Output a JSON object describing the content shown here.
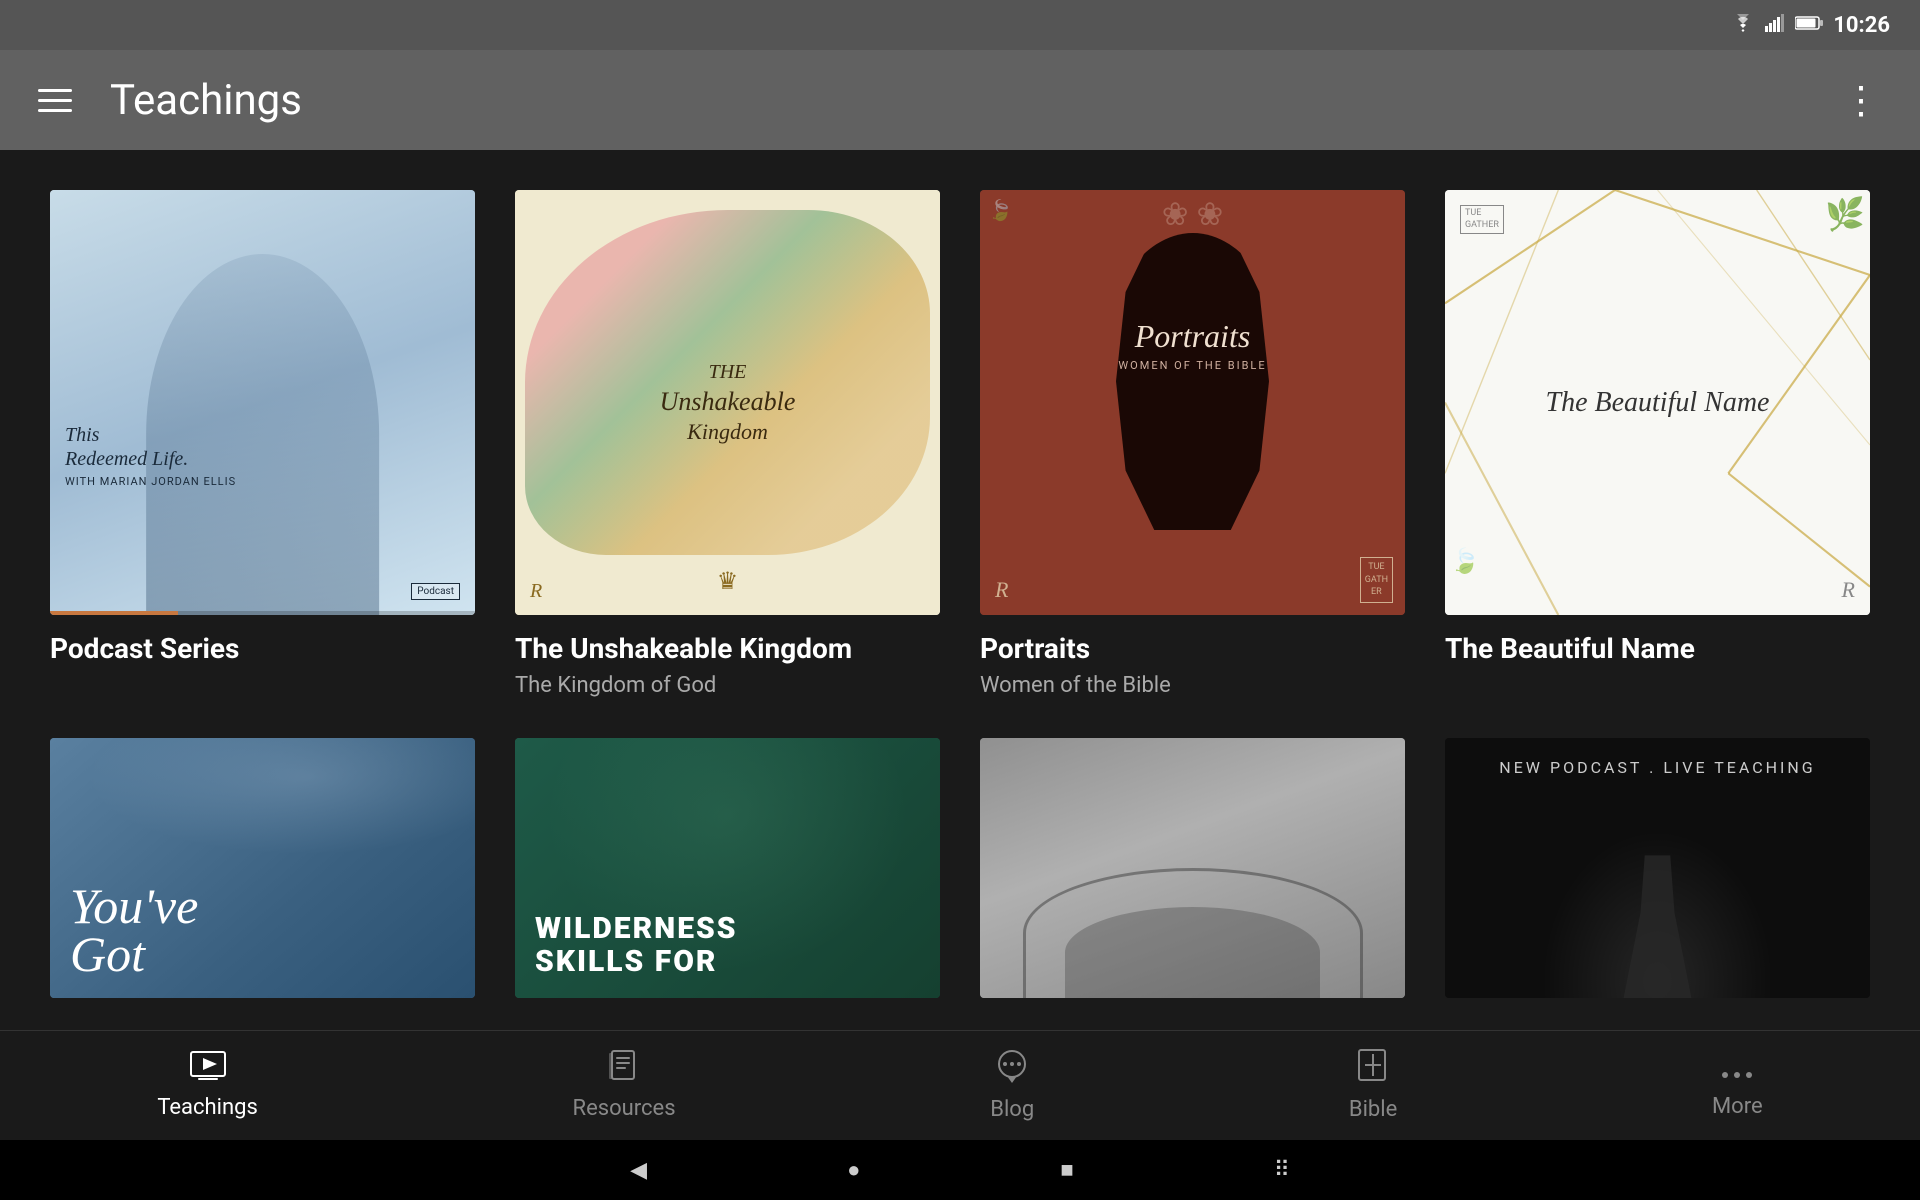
{
  "statusBar": {
    "time": "10:26",
    "wifiIcon": "wifi",
    "signalIcon": "signal",
    "batteryIcon": "battery"
  },
  "appBar": {
    "title": "Teachings",
    "menuIcon": "hamburger",
    "moreIcon": "more-vertical"
  },
  "cards": [
    {
      "id": "podcast-series",
      "imageAlt": "This Redeemed Life Podcast with Marian Jordan Ellis",
      "title": "Podcast Series",
      "subtitle": "",
      "imageText1": "This Redeemed Life",
      "imageText2": "WITH MARIAN JORDAN ELLIS",
      "imageText3": "Podcast"
    },
    {
      "id": "unshakeable-kingdom",
      "imageAlt": "The Unshakeable Kingdom colorful artwork",
      "title": "The Unshakeable Kingdom",
      "subtitle": "The Kingdom of God",
      "imageText1": "THE Unshakeable Kingdom"
    },
    {
      "id": "portraits",
      "imageAlt": "Portraits Women of the Bible red cover",
      "title": "Portraits",
      "subtitle": "Women of the Bible",
      "imageText1": "Portraits",
      "imageText2": "WOMEN OF THE BIBLE"
    },
    {
      "id": "beautiful-name",
      "imageAlt": "The Beautiful Name white cover with gold lines",
      "title": "The Beautiful Name",
      "subtitle": "",
      "imageText1": "The Beautiful Name"
    },
    {
      "id": "youve-got",
      "imageAlt": "You've Got teaching series",
      "title": "",
      "subtitle": "",
      "imageText1": "You've\nGot"
    },
    {
      "id": "wilderness-skills",
      "imageAlt": "Wilderness Skills For cover",
      "title": "",
      "subtitle": "",
      "imageText1": "WILDERNESS\nSKILLS FOR"
    },
    {
      "id": "bridge-series",
      "imageAlt": "Bridge archway grey photo",
      "title": "",
      "subtitle": ""
    },
    {
      "id": "new-podcast-live",
      "imageAlt": "NEW Podcast Live Teaching",
      "title": "",
      "subtitle": "",
      "imageText1": "NEW PODCAST . LIVE TEACHING"
    }
  ],
  "bottomNav": {
    "items": [
      {
        "id": "teachings",
        "label": "Teachings",
        "icon": "play-square",
        "active": true
      },
      {
        "id": "resources",
        "label": "Resources",
        "icon": "book-open",
        "active": false
      },
      {
        "id": "blog",
        "label": "Blog",
        "icon": "chat-bubble",
        "active": false
      },
      {
        "id": "bible",
        "label": "Bible",
        "icon": "bible-cross",
        "active": false
      },
      {
        "id": "more",
        "label": "More",
        "icon": "more-dots",
        "active": false
      }
    ]
  },
  "sysNav": {
    "backIcon": "◀",
    "homeIcon": "●",
    "recentIcon": "■",
    "keyboardIcon": "⠿"
  }
}
